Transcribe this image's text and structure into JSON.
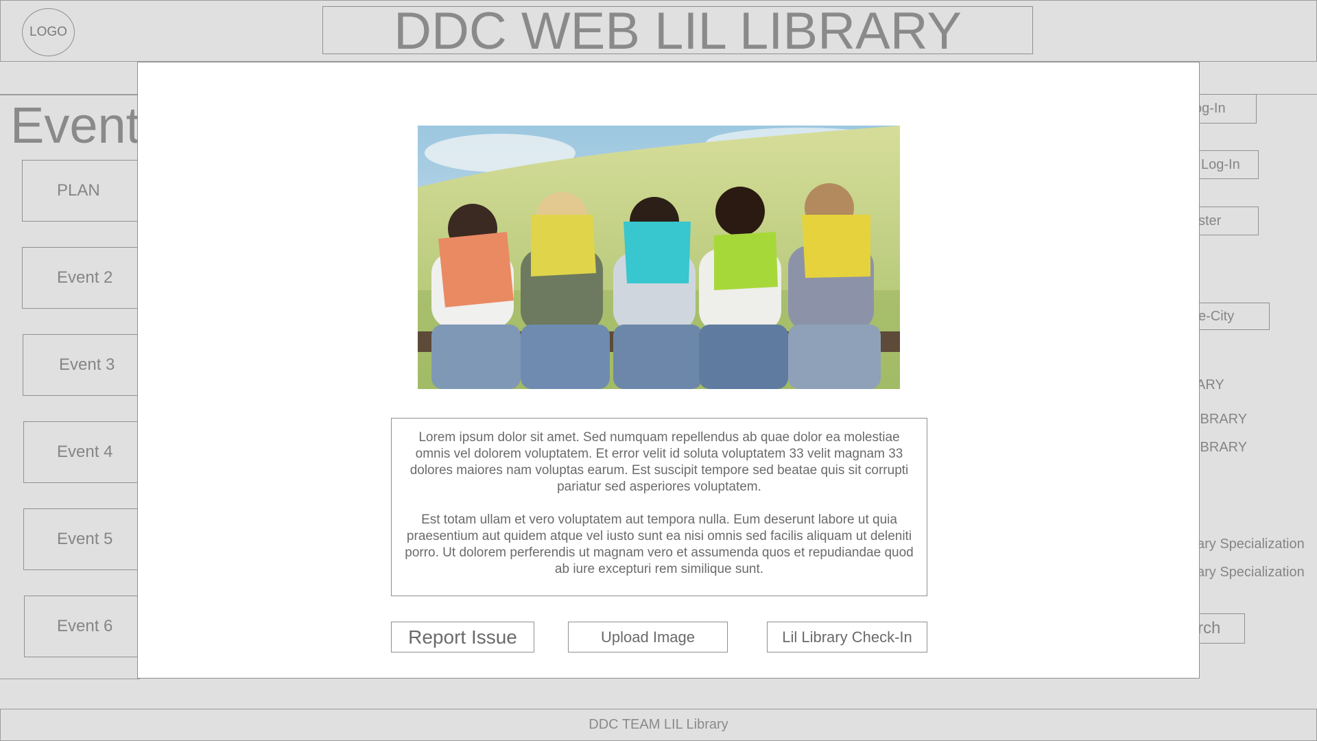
{
  "header": {
    "logo_label": "LOGO",
    "title": "DDC WEB LIL LIBRARY"
  },
  "sidebar": {
    "heading": "Events",
    "items": [
      {
        "label": "PLAN"
      },
      {
        "label": "Event 2"
      },
      {
        "label": "Event 3"
      },
      {
        "label": "Event 4"
      },
      {
        "label": "Event 5"
      },
      {
        "label": "Event 6"
      }
    ]
  },
  "right_panel": {
    "items": [
      {
        "label": "og-In"
      },
      {
        "label": "l Log-In"
      },
      {
        "label": "ster"
      },
      {
        "label": "e-City"
      },
      {
        "label": "ARY"
      },
      {
        "label": "IBRARY"
      },
      {
        "label": "IBRARY"
      },
      {
        "label": "ary Specialization"
      },
      {
        "label": "ary Specialization"
      },
      {
        "label": "rch"
      }
    ]
  },
  "modal": {
    "image_alt": "Children reading colorful books on a bench in a field",
    "paragraphs": [
      "Lorem ipsum dolor sit amet. Sed numquam repellendus ab quae dolor ea molestiae omnis vel dolorem voluptatem. Et error velit id soluta voluptatem 33 velit magnam 33 dolores maiores nam voluptas earum. Est suscipit tempore sed beatae quis sit corrupti pariatur sed asperiores voluptatem.",
      "Est totam ullam et vero voluptatem aut tempora nulla. Eum deserunt labore ut quia praesentium aut quidem atque vel iusto sunt ea nisi omnis sed facilis aliquam ut deleniti porro. Ut dolorem perferendis ut magnam vero et assumenda quos et repudiandae quod ab iure excepturi rem similique sunt."
    ],
    "buttons": {
      "report_issue": "Report Issue",
      "upload_image": "Upload Image",
      "checkin": "Lil Library Check-In"
    }
  },
  "footer": {
    "text": "DDC TEAM LIL Library"
  },
  "colors": {
    "background": "#e0e0e0",
    "modal_background": "#ffffff",
    "border": "#8f8f8f",
    "text": "#858585"
  }
}
